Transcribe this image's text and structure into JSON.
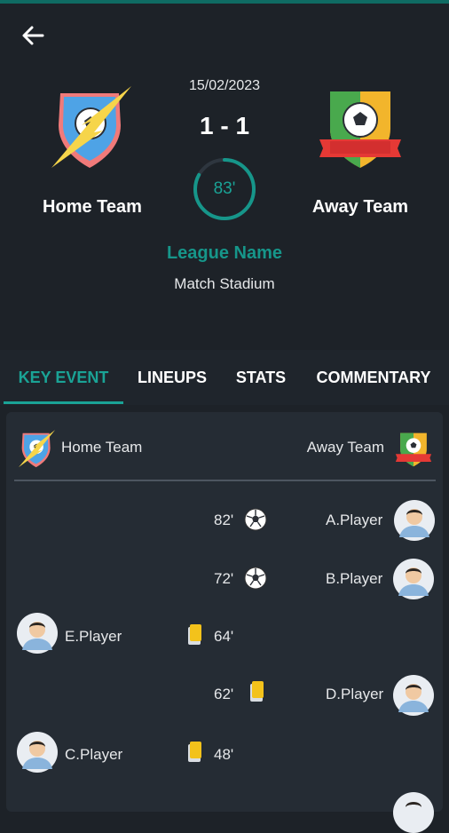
{
  "match": {
    "date": "15/02/2023",
    "score": "1 - 1",
    "minute": "83'",
    "minute_progress": 0.83,
    "home_team": "Home Team",
    "away_team": "Away Team",
    "league": "League Name",
    "stadium": "Match Stadium"
  },
  "tabs": [
    {
      "label": "KEY EVENT",
      "active": true
    },
    {
      "label": "LINEUPS",
      "active": false
    },
    {
      "label": "STATS",
      "active": false
    },
    {
      "label": "COMMENTARY",
      "active": false
    }
  ],
  "panel": {
    "home_label": "Home Team",
    "away_label": "Away Team"
  },
  "events": [
    {
      "minute": "82'",
      "type": "goal",
      "side": "away",
      "player": "A.Player"
    },
    {
      "minute": "72'",
      "type": "goal",
      "side": "away",
      "player": "B.Player"
    },
    {
      "minute": "64'",
      "type": "yellow-card",
      "side": "home",
      "player": "E.Player"
    },
    {
      "minute": "62'",
      "type": "yellow-card",
      "side": "away",
      "player": "D.Player"
    },
    {
      "minute": "48'",
      "type": "yellow-card",
      "side": "home",
      "player": "C.Player"
    }
  ],
  "colors": {
    "background": "#1d2228",
    "accent": "#1aa396",
    "panel": "#252c34",
    "yellow_card": "#f3c21b"
  },
  "icons": {
    "back": "arrow-left-icon",
    "goal": "soccer-ball-icon",
    "card": "yellow-card-icon",
    "avatar": "player-avatar"
  }
}
